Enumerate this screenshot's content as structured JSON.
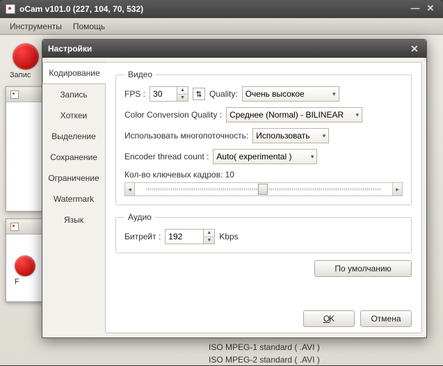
{
  "main": {
    "title": "oCam v101.0 (227, 104, 70, 532)",
    "menu": {
      "tools": "Инструменты",
      "help": "Помощь"
    },
    "record_label": "Запис",
    "bg_list": [
      "ISO MPEG-1 standard ( .AVI )",
      "ISO MPEG-2 standard ( .AVI )"
    ]
  },
  "dialog": {
    "title": "Настройки",
    "tabs": [
      "Кодирование",
      "Запись",
      "Хоткеи",
      "Выделение",
      "Сохранение",
      "Ограничение",
      "Watermark",
      "Язык"
    ],
    "video": {
      "legend": "Видео",
      "fps_label": "FPS :",
      "fps_value": "30",
      "quality_label": "Quality:",
      "quality_value": "Очень высокое",
      "ccq_label": "Color Conversion Quality :",
      "ccq_value": "Среднее (Normal) - BILINEAR",
      "multithread_label": "Использовать многопоточность:",
      "multithread_value": "Использовать",
      "threadcount_label": "Encoder thread count :",
      "threadcount_value": "Auto( experimental )",
      "keyframes_label": "Кол-во ключевых кадров: 10"
    },
    "audio": {
      "legend": "Аудио",
      "bitrate_label": "Битрейт :",
      "bitrate_value": "192",
      "bitrate_unit": "Kbps"
    },
    "buttons": {
      "defaults": "По умолчанию",
      "ok": "OK",
      "cancel": "Отмена"
    }
  }
}
